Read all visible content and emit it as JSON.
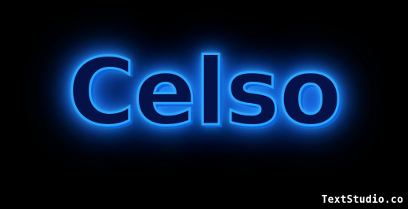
{
  "text_effect": {
    "word": "Celso",
    "fill_color": "#05124a",
    "glow_color": "#2a9cff",
    "outline_color": "#2aa6ff",
    "background_color": "#000000"
  },
  "watermark": {
    "label": "TextStudio.co"
  }
}
